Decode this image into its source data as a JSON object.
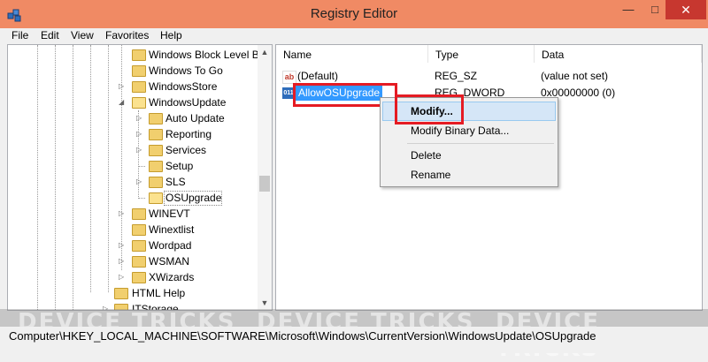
{
  "window": {
    "title": "Registry Editor",
    "min_glyph": "—",
    "max_glyph": "□",
    "close_glyph": "✕"
  },
  "menu": [
    "File",
    "Edit",
    "View",
    "Favorites",
    "Help"
  ],
  "tree": {
    "items": [
      {
        "label": "Windows Block Level B",
        "expander": ""
      },
      {
        "label": "Windows To Go",
        "expander": ""
      },
      {
        "label": "WindowsStore",
        "expander": "▷"
      },
      {
        "label": "WindowsUpdate",
        "expander": "◢"
      },
      {
        "label": "Auto Update",
        "expander": "▷"
      },
      {
        "label": "Reporting",
        "expander": "▷"
      },
      {
        "label": "Services",
        "expander": "▷"
      },
      {
        "label": "Setup",
        "expander": ""
      },
      {
        "label": "SLS",
        "expander": "▷"
      },
      {
        "label": "OSUpgrade",
        "expander": ""
      },
      {
        "label": "WINEVT",
        "expander": "▷"
      },
      {
        "label": "Winextlist",
        "expander": ""
      },
      {
        "label": "Wordpad",
        "expander": "▷"
      },
      {
        "label": "WSMAN",
        "expander": "▷"
      },
      {
        "label": "XWizards",
        "expander": "▷"
      },
      {
        "label": "HTML Help",
        "expander": ""
      },
      {
        "label": "ITStorage",
        "expander": "▷"
      }
    ],
    "selected": "OSUpgrade"
  },
  "list": {
    "columns": [
      "Name",
      "Type",
      "Data"
    ],
    "rows": [
      {
        "name": "(Default)",
        "type": "REG_SZ",
        "data": "(value not set)",
        "icon": "string-value-icon"
      },
      {
        "name": "AllowOSUpgrade",
        "type": "REG_DWORD",
        "data": "0x00000000 (0)",
        "icon": "dword-value-icon"
      }
    ],
    "selected_row": "AllowOSUpgrade"
  },
  "context_menu": {
    "items": [
      "Modify...",
      "Modify Binary Data...",
      "Delete",
      "Rename"
    ],
    "highlighted": "Modify..."
  },
  "status": {
    "path": "Computer\\HKEY_LOCAL_MACHINE\\SOFTWARE\\Microsoft\\Windows\\CurrentVersion\\WindowsUpdate\\OSUpgrade"
  },
  "watermark": {
    "text": "DEVICE TRICKS"
  },
  "colors": {
    "titlebar": "#f08a64",
    "close": "#c7372f",
    "selection": "#3399ff",
    "highlight_box": "#e51b23",
    "menu_hover": "#d5e6f7"
  }
}
